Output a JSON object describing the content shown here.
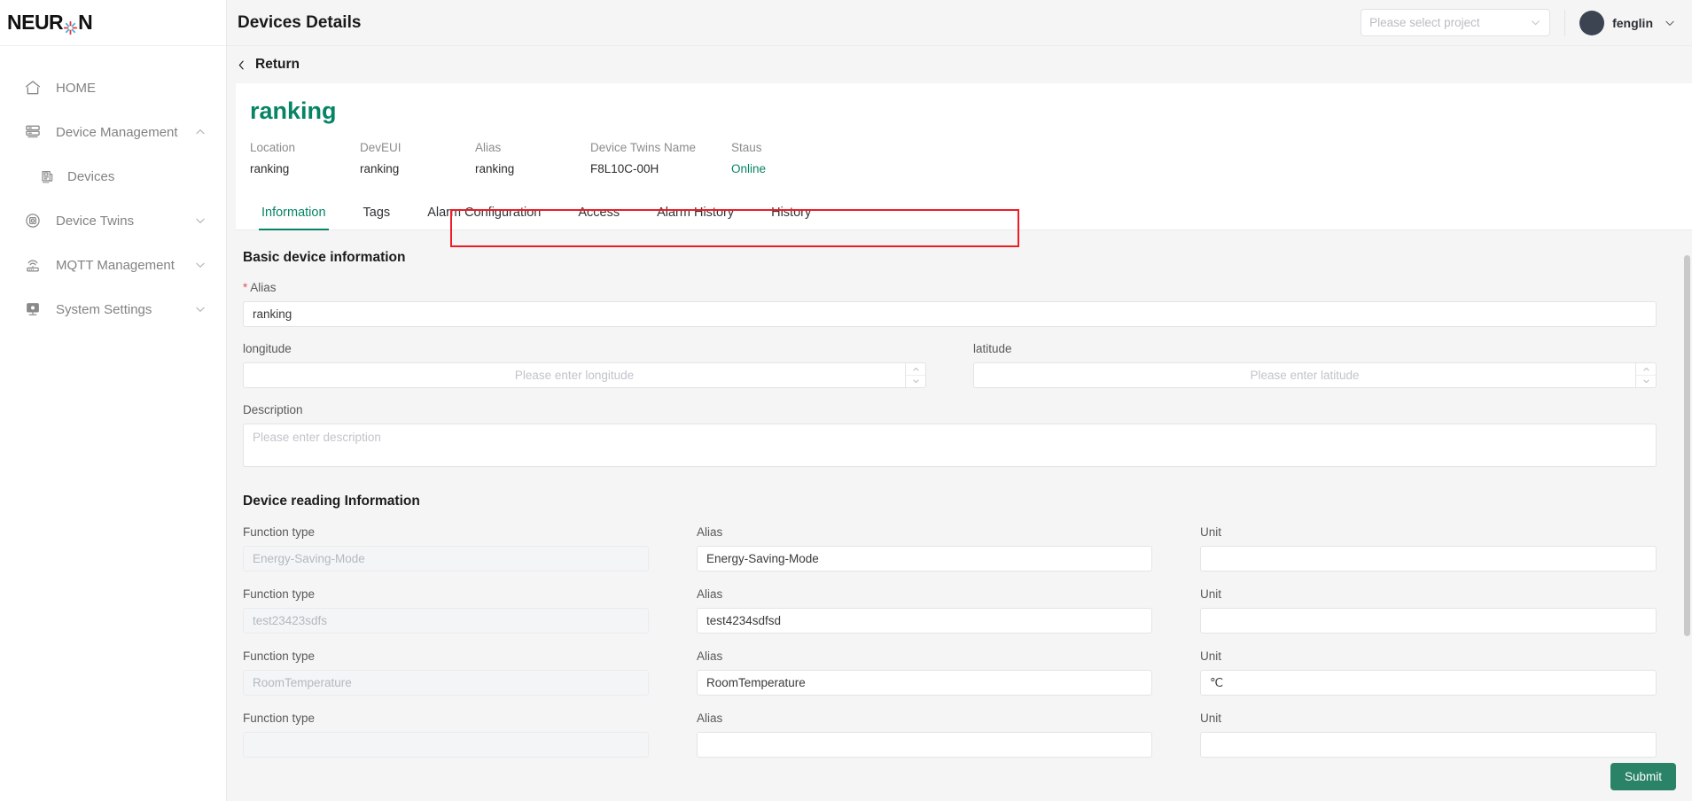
{
  "brand": {
    "name": "NEUR",
    "name_tail": "N",
    "logo_icon": "asterisk-logo-icon"
  },
  "accent": {
    "green": "#068465",
    "green_button": "#2a8267",
    "red_highlight": "#ee1c25",
    "required_red": "#e8505b"
  },
  "sidebar": {
    "items": [
      {
        "label": "HOME",
        "icon": "home-icon",
        "name": "home",
        "sub": false,
        "chevron": ""
      },
      {
        "label": "Device Management",
        "icon": "server-icon",
        "name": "device-management",
        "sub": false,
        "chevron": "up"
      },
      {
        "label": "Devices",
        "icon": "device-icon",
        "name": "devices",
        "sub": true,
        "chevron": ""
      },
      {
        "label": "Device Twins",
        "icon": "twins-icon",
        "name": "device-twins",
        "sub": false,
        "chevron": "down"
      },
      {
        "label": "MQTT Management",
        "icon": "router-icon",
        "name": "mqtt-management",
        "sub": false,
        "chevron": "down"
      },
      {
        "label": "System Settings",
        "icon": "monitor-icon",
        "name": "system-settings",
        "sub": false,
        "chevron": "down"
      }
    ]
  },
  "topbar": {
    "title": "Devices Details",
    "project_select": {
      "placeholder": "Please select project",
      "value": "",
      "icon": "chevron-down-icon"
    },
    "user": {
      "name": "fenglin",
      "avatar": "avatar",
      "icon": "chevron-down-icon"
    }
  },
  "return": {
    "label": "Return",
    "icon": "chevron-left-icon"
  },
  "device": {
    "name": "ranking",
    "meta": [
      {
        "label": "Location",
        "value": "ranking",
        "status": false
      },
      {
        "label": "DevEUI",
        "value": "ranking",
        "status": false
      },
      {
        "label": "Alias",
        "value": "ranking",
        "status": false
      },
      {
        "label": "Device Twins Name",
        "value": "F8L10C-00H",
        "status": false
      },
      {
        "label": "Staus",
        "value": "Online",
        "status": true
      }
    ]
  },
  "tabs": [
    {
      "label": "Information",
      "active": true
    },
    {
      "label": "Tags",
      "active": false
    },
    {
      "label": "Alarm Configuration",
      "active": false
    },
    {
      "label": "Access",
      "active": false
    },
    {
      "label": "Alarm History",
      "active": false
    },
    {
      "label": "History",
      "active": false
    }
  ],
  "basic": {
    "section_title": "Basic device information",
    "alias": {
      "label": "Alias",
      "required_mark": "*",
      "value": "ranking",
      "placeholder": ""
    },
    "longitude": {
      "label": "longitude",
      "value": "",
      "placeholder": "Please enter longitude"
    },
    "latitude": {
      "label": "latitude",
      "value": "",
      "placeholder": "Please enter latitude"
    },
    "description": {
      "label": "Description",
      "value": "",
      "placeholder": "Please enter description"
    }
  },
  "reading": {
    "section_title": "Device reading Information",
    "col_labels": {
      "function_type": "Function type",
      "alias": "Alias",
      "unit": "Unit"
    },
    "rows": [
      {
        "function_type": "Energy-Saving-Mode",
        "alias": "Energy-Saving-Mode",
        "unit": ""
      },
      {
        "function_type": "test23423sdfs",
        "alias": "test4234sdfsd",
        "unit": ""
      },
      {
        "function_type": "RoomTemperature",
        "alias": "RoomTemperature",
        "unit": "℃"
      },
      {
        "function_type": "",
        "alias": "",
        "unit": ""
      }
    ]
  },
  "submit": {
    "label": "Submit"
  }
}
